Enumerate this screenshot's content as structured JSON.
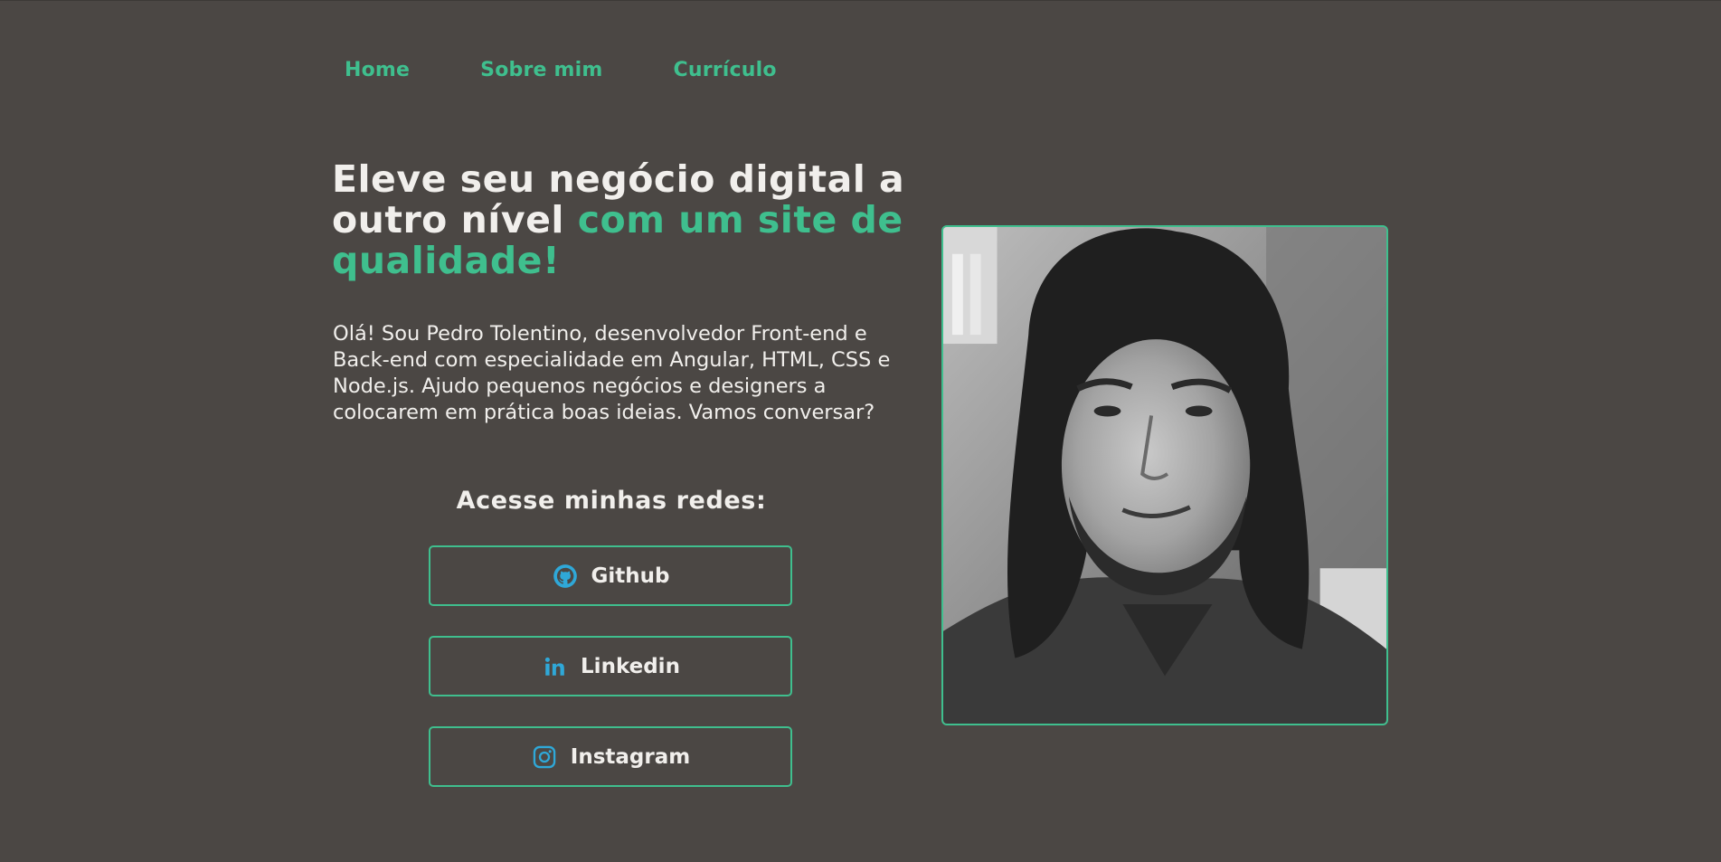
{
  "nav": {
    "home": "Home",
    "about": "Sobre mim",
    "resume": "Currículo"
  },
  "hero": {
    "title_part1": "Eleve seu negócio digital a outro nível ",
    "title_accent": "com um site de qualidade!",
    "intro": "Olá! Sou Pedro Tolentino, desenvolvedor Front-end e Back-end com especialidade em Angular, HTML, CSS e Node.js. Ajudo pequenos negócios e designers a colocarem em prática boas ideias. Vamos conversar?"
  },
  "socials": {
    "title": "Acesse minhas redes:",
    "items": [
      {
        "label": "Github",
        "icon": "github-icon"
      },
      {
        "label": "Linkedin",
        "icon": "linkedin-icon"
      },
      {
        "label": "Instagram",
        "icon": "instagram-icon"
      }
    ]
  },
  "photo": {
    "subject": "profile-photo"
  },
  "colors": {
    "background": "#4b4744",
    "accent": "#3fbf8e",
    "text": "#f1efec",
    "icon": "#2fa8d8"
  }
}
